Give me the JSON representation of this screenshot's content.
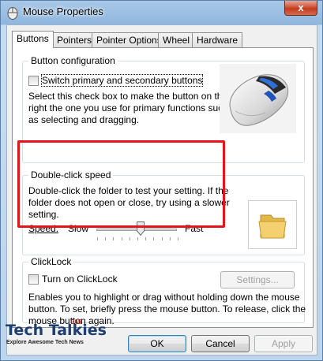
{
  "window": {
    "title": "Mouse Properties",
    "close_label": "x"
  },
  "tabs": [
    {
      "label": "Buttons"
    },
    {
      "label": "Pointers"
    },
    {
      "label": "Pointer Options"
    },
    {
      "label": "Wheel"
    },
    {
      "label": "Hardware"
    }
  ],
  "button_config": {
    "legend": "Button configuration",
    "checkbox_label": "Switch primary and secondary buttons",
    "checked": false,
    "desc_lines": [
      "Select this check box to make the button on the",
      "right the one you use for primary functions such",
      "as selecting and dragging."
    ]
  },
  "double_click": {
    "legend": "Double-click speed",
    "desc_lines": [
      "Double-click the folder to test your setting. If the",
      "folder does not open or close, try using a slower",
      "setting."
    ],
    "speed_label": "Speed:",
    "slow_label": "Slow",
    "fast_label": "Fast",
    "speed_value": 0.55
  },
  "clicklock": {
    "legend": "ClickLock",
    "checkbox_label": "Turn on ClickLock",
    "checked": false,
    "settings_label": "Settings...",
    "desc_lines": [
      "Enables you to highlight or drag without holding down the mouse",
      "button. To set, briefly press the mouse button. To release, click the",
      "mouse button again."
    ]
  },
  "footer": {
    "ok_label": "OK",
    "cancel_label": "Cancel",
    "apply_label": "Apply"
  },
  "watermark": {
    "brand": "Tech Talkies",
    "brand_sup": "365",
    "tagline": "Explore Awesome Tech News"
  },
  "colors": {
    "highlight": "#e5141a",
    "title_bar": "#a9c8e8"
  }
}
